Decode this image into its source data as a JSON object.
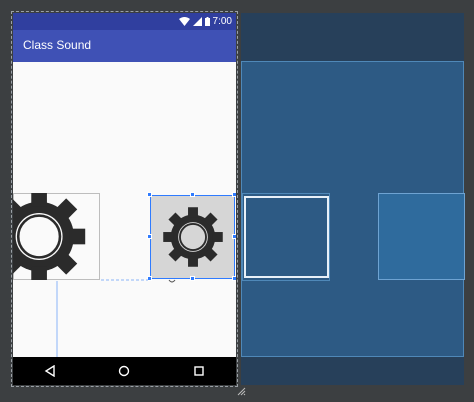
{
  "status_bar": {
    "time": "7:00"
  },
  "app_bar": {
    "title": "Class Sound"
  },
  "images": [
    {
      "name": "gear-image-1",
      "icon": "gear-icon"
    },
    {
      "name": "gear-image-2",
      "icon": "gear-icon",
      "selected": true
    }
  ],
  "navigation": [
    "back-icon",
    "home-icon",
    "recents-icon"
  ],
  "colors": {
    "status_bar": "#303f9f",
    "app_bar": "#3f51b5",
    "blueprint": "#2d5a84",
    "selection": "#2f7bff",
    "editor_background": "#3c3f41"
  }
}
